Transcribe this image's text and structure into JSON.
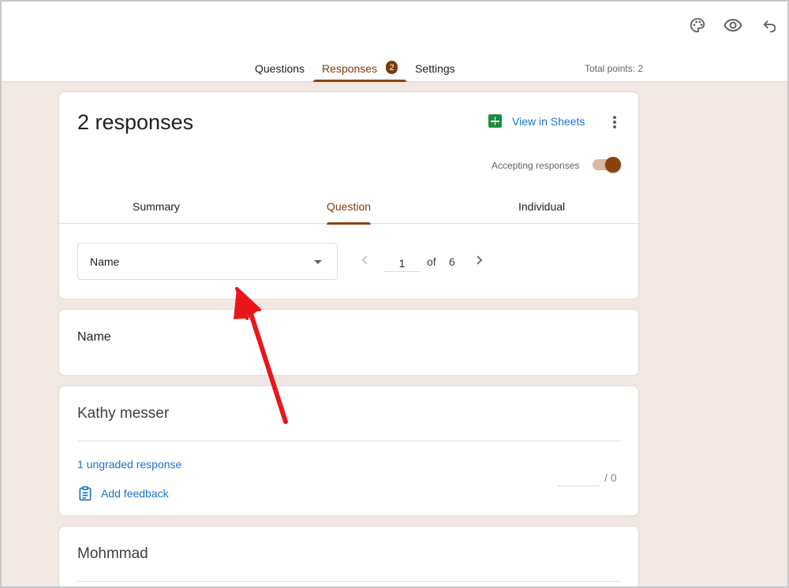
{
  "header": {
    "icons": [
      "palette-icon",
      "eye-icon",
      "undo-icon"
    ],
    "tabs": [
      {
        "label": "Questions"
      },
      {
        "label": "Responses",
        "badge": "2"
      },
      {
        "label": "Settings"
      }
    ],
    "total_points": "Total points: 2"
  },
  "summary_card": {
    "title": "2 responses",
    "view_sheets": "View in Sheets",
    "accepting_label": "Accepting responses",
    "accepting_on": true,
    "subtabs": [
      "Summary",
      "Question",
      "Individual"
    ],
    "active_subtab": "Question",
    "question_select": "Name",
    "pager": {
      "current": "1",
      "of": "of",
      "total": "6"
    }
  },
  "question_card": {
    "title": "Name"
  },
  "answers": [
    {
      "text": "Kathy messer",
      "ungraded": "1 ungraded response",
      "add_feedback": "Add feedback",
      "score_max": "/ 0"
    },
    {
      "text": "Mohmmad"
    }
  ],
  "colors": {
    "accent": "#8a420f",
    "link": "#1a73c8",
    "background": "#f1e8e3",
    "sheets": "#1e8e3e",
    "annotation_arrow": "#e8161b"
  }
}
